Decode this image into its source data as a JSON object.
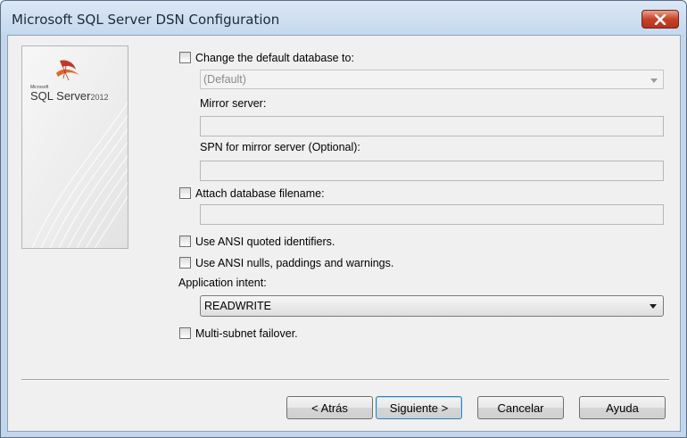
{
  "window": {
    "title": "Microsoft SQL Server DSN Configuration"
  },
  "icons": {
    "close": "close-icon",
    "logo": "sql-server-logo"
  },
  "logo": {
    "small_text": "Microsoft",
    "main_text": "SQL Server",
    "year": "2012"
  },
  "options": {
    "change_db": {
      "label": "Change the default database to:",
      "checked": false,
      "value": "(Default)"
    },
    "mirror_server": {
      "label": "Mirror server:",
      "value": ""
    },
    "spn_mirror": {
      "label": "SPN for mirror server (Optional):",
      "value": ""
    },
    "attach_db": {
      "label": "Attach database filename:",
      "checked": false,
      "value": ""
    },
    "ansi_quoted": {
      "label": "Use ANSI quoted identifiers.",
      "checked": false
    },
    "ansi_nulls": {
      "label": "Use ANSI nulls, paddings and warnings.",
      "checked": false
    },
    "app_intent": {
      "label": "Application intent:",
      "value": "READWRITE"
    },
    "multi_subnet": {
      "label": "Multi-subnet failover.",
      "checked": false
    }
  },
  "buttons": {
    "back": "< Atrás",
    "next": "Siguiente >",
    "cancel": "Cancelar",
    "help": "Ayuda"
  },
  "colors": {
    "title_bar": "#c5d8ee",
    "close_button": "#c6432a",
    "logo_accent": "#c0392b"
  }
}
